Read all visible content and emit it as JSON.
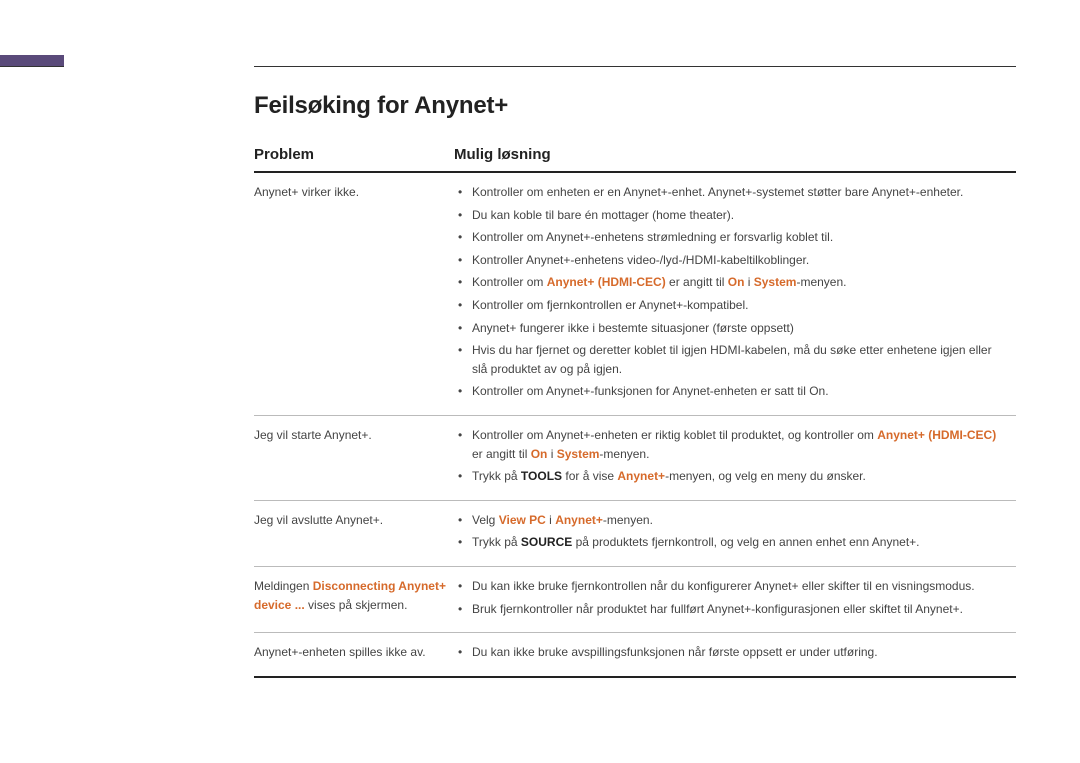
{
  "title": "Feilsøking for Anynet+",
  "headers": {
    "problem": "Problem",
    "solution": "Mulig løsning"
  },
  "rows": [
    {
      "problem": [
        [
          "Anynet+ virker ikke."
        ]
      ],
      "items": [
        [
          [
            "Kontroller om enheten er en Anynet+-enhet. Anynet+-systemet støtter bare Anynet+-enheter."
          ]
        ],
        [
          [
            "Du kan koble til bare én mottager (home theater)."
          ]
        ],
        [
          [
            "Kontroller om Anynet+-enhetens strømledning er forsvarlig koblet til."
          ]
        ],
        [
          [
            "Kontroller Anynet+-enhetens video-/lyd-/HDMI-kabeltilkoblinger."
          ]
        ],
        [
          [
            "Kontroller om "
          ],
          [
            "Anynet+ (HDMI-CEC)",
            "em"
          ],
          [
            " er angitt til "
          ],
          [
            "On",
            "em"
          ],
          [
            " i "
          ],
          [
            "System",
            "em"
          ],
          [
            "-menyen."
          ]
        ],
        [
          [
            "Kontroller om fjernkontrollen er Anynet+-kompatibel."
          ]
        ],
        [
          [
            "Anynet+ fungerer ikke i bestemte situasjoner (første oppsett)"
          ]
        ],
        [
          [
            "Hvis du har fjernet og deretter koblet til igjen HDMI-kabelen, må du søke etter enhetene igjen eller slå produktet av og på igjen."
          ]
        ],
        [
          [
            "Kontroller om Anynet+-funksjonen for Anynet-enheten er satt til On."
          ]
        ]
      ]
    },
    {
      "problem": [
        [
          "Jeg vil starte Anynet+."
        ]
      ],
      "items": [
        [
          [
            "Kontroller om Anynet+-enheten er riktig koblet til produktet, og kontroller om "
          ],
          [
            "Anynet+ (HDMI-CEC)",
            "em"
          ],
          [
            " er angitt til "
          ],
          [
            "On",
            "em"
          ],
          [
            " i "
          ],
          [
            "System",
            "em"
          ],
          [
            "-menyen."
          ]
        ],
        [
          [
            "Trykk på "
          ],
          [
            "TOOLS",
            "bold"
          ],
          [
            " for å vise "
          ],
          [
            "Anynet+",
            "em"
          ],
          [
            "-menyen, og velg en meny du ønsker."
          ]
        ]
      ]
    },
    {
      "problem": [
        [
          "Jeg vil avslutte Anynet+."
        ]
      ],
      "items": [
        [
          [
            "Velg "
          ],
          [
            "View PC",
            "em"
          ],
          [
            " i "
          ],
          [
            "Anynet+",
            "em"
          ],
          [
            "-menyen."
          ]
        ],
        [
          [
            "Trykk på "
          ],
          [
            "SOURCE",
            "bold"
          ],
          [
            " på produktets fjernkontroll, og velg en annen enhet enn Anynet+."
          ]
        ]
      ]
    },
    {
      "problem": [
        [
          "Meldingen "
        ],
        [
          "Disconnecting Anynet+  device ...",
          "em"
        ],
        [
          " vises på skjermen."
        ]
      ],
      "items": [
        [
          [
            "Du kan ikke bruke fjernkontrollen når du konfigurerer Anynet+ eller skifter til en visningsmodus."
          ]
        ],
        [
          [
            "Bruk fjernkontroller når produktet har fullført Anynet+-konfigurasjonen eller skiftet til Anynet+."
          ]
        ]
      ]
    },
    {
      "problem": [
        [
          "Anynet+-enheten spilles ikke av."
        ]
      ],
      "items": [
        [
          [
            "Du kan ikke bruke avspillingsfunksjonen når første oppsett er under utføring."
          ]
        ]
      ]
    }
  ]
}
